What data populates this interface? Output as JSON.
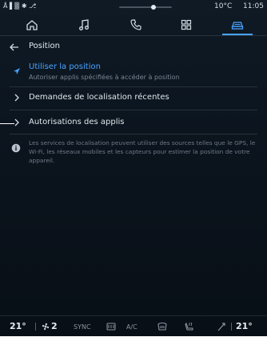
{
  "status_bar": {
    "left_glyphs": "Å ▌▒ ✱ ⎇",
    "temperature": "10°C",
    "time": "11:05"
  },
  "tabs": [
    {
      "icon": "home-icon",
      "active": false
    },
    {
      "icon": "music-icon",
      "active": false
    },
    {
      "icon": "phone-icon",
      "active": false
    },
    {
      "icon": "apps-grid-icon",
      "active": false
    },
    {
      "icon": "car-icon",
      "active": true
    }
  ],
  "header": {
    "title": "Position"
  },
  "location_toggle": {
    "title": "Utiliser la position",
    "subtitle": "Autoriser applis spécifiées à accéder à position"
  },
  "nav_items": {
    "recent": "Demandes de localisation récentes",
    "app_permissions": "Autorisations des applis"
  },
  "info": {
    "text": "Les services de localisation peuvent utiliser des sources telles que le GPS, le Wi-Fi, les réseaux mobiles et les capteurs pour estimer la position de votre appareil."
  },
  "climate": {
    "left_temp": "21°",
    "fan_level": "2",
    "sync": "SYNC",
    "ac": "A/C",
    "right_temp": "21°"
  },
  "colors": {
    "accent": "#4aa3ff",
    "background": "#0c151f"
  }
}
